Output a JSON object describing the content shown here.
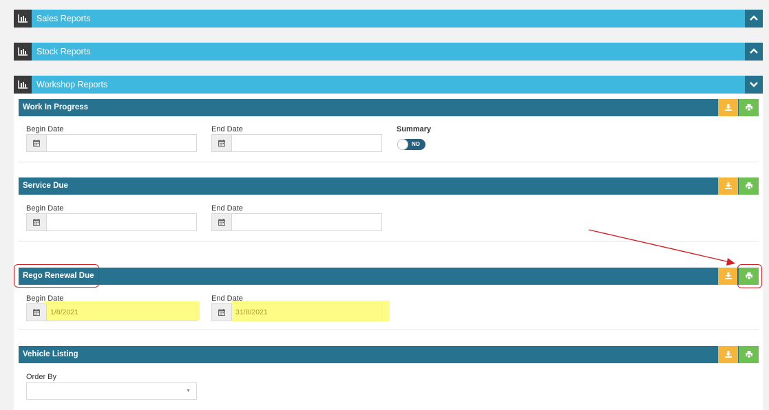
{
  "sections": [
    {
      "title": "Sales Reports",
      "icon": "bar-chart-icon",
      "toggle": "chevron-up-icon"
    },
    {
      "title": "Stock Reports",
      "icon": "bar-chart-icon",
      "toggle": "chevron-up-icon"
    },
    {
      "title": "Workshop Reports",
      "icon": "bar-chart-icon",
      "toggle": "chevron-down-icon"
    }
  ],
  "reports": {
    "wip": {
      "title": "Work In Progress",
      "begin_label": "Begin Date",
      "begin_value": "",
      "end_label": "End Date",
      "end_value": "",
      "summary_label": "Summary",
      "summary_toggle": "NO"
    },
    "service_due": {
      "title": "Service Due",
      "begin_label": "Begin Date",
      "begin_value": "",
      "end_label": "End Date",
      "end_value": ""
    },
    "rego": {
      "title": "Rego Renewal Due",
      "begin_label": "Begin Date",
      "begin_value": "1/8/2021",
      "end_label": "End Date",
      "end_value": "31/8/2021"
    },
    "vehicle_listing": {
      "title": "Vehicle Listing",
      "order_label": "Order By",
      "order_value": ""
    }
  },
  "icons": {
    "download": "download-icon",
    "print": "print-icon",
    "calendar": "calendar-icon"
  },
  "colors": {
    "section_bar": "#3fb8e0",
    "report_bar": "#26728f",
    "download_button": "#f6b63b",
    "print_button": "#6fc052",
    "annotation": "#d42025",
    "highlight": "#fdfb6e"
  }
}
